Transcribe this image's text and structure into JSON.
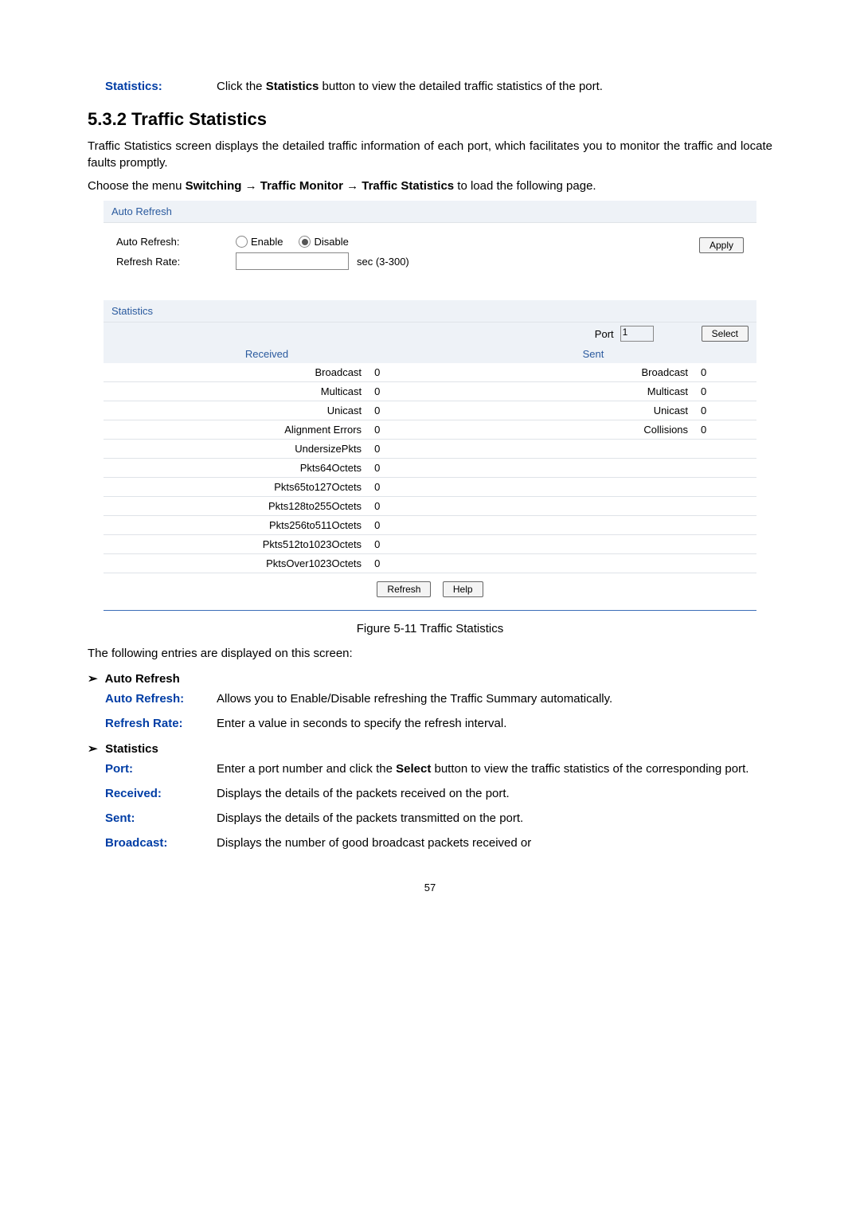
{
  "top_desc": {
    "label": "Statistics:",
    "text_prefix": "Click the ",
    "text_bold": "Statistics",
    "text_suffix": " button to view the detailed traffic statistics of the port."
  },
  "heading": "5.3.2 Traffic Statistics",
  "intro": "Traffic Statistics screen displays the detailed traffic information of each port, which facilitates you to monitor the traffic and locate faults promptly.",
  "menu_line_prefix": "Choose the menu ",
  "menu_line_bold": "Switching → Traffic Monitor → Traffic Statistics",
  "menu_line_suffix": " to load the following page.",
  "auto_refresh_panel": {
    "title": "Auto Refresh",
    "auto_refresh_label": "Auto Refresh:",
    "enable_label": "Enable",
    "disable_label": "Disable",
    "refresh_rate_label": "Refresh Rate:",
    "rate_hint": "sec (3-300)",
    "apply_button": "Apply"
  },
  "stats_panel": {
    "title": "Statistics",
    "port_label": "Port",
    "port_value": "1",
    "select_button": "Select",
    "received_header": "Received",
    "sent_header": "Sent",
    "received_rows": [
      {
        "label": "Broadcast",
        "value": "0"
      },
      {
        "label": "Multicast",
        "value": "0"
      },
      {
        "label": "Unicast",
        "value": "0"
      },
      {
        "label": "Alignment Errors",
        "value": "0"
      },
      {
        "label": "UndersizePkts",
        "value": "0"
      },
      {
        "label": "Pkts64Octets",
        "value": "0"
      },
      {
        "label": "Pkts65to127Octets",
        "value": "0"
      },
      {
        "label": "Pkts128to255Octets",
        "value": "0"
      },
      {
        "label": "Pkts256to511Octets",
        "value": "0"
      },
      {
        "label": "Pkts512to1023Octets",
        "value": "0"
      },
      {
        "label": "PktsOver1023Octets",
        "value": "0"
      }
    ],
    "sent_rows": [
      {
        "label": "Broadcast",
        "value": "0"
      },
      {
        "label": "Multicast",
        "value": "0"
      },
      {
        "label": "Unicast",
        "value": "0"
      },
      {
        "label": "Collisions",
        "value": "0"
      }
    ],
    "refresh_button": "Refresh",
    "help_button": "Help"
  },
  "figure_caption": "Figure 5-11 Traffic Statistics",
  "entries_intro": "The following entries are displayed on this screen:",
  "section1_title": "Auto Refresh",
  "section2_title": "Statistics",
  "entries1": [
    {
      "label": "Auto Refresh:",
      "text": "Allows you to Enable/Disable refreshing the Traffic Summary automatically."
    },
    {
      "label": "Refresh Rate:",
      "text": "Enter a value in seconds to specify the refresh interval."
    }
  ],
  "entries2": [
    {
      "label": "Port:",
      "text_prefix": "Enter a port number and click the ",
      "text_bold": "Select",
      "text_suffix": " button to view the traffic statistics of the corresponding port."
    },
    {
      "label": "Received:",
      "text": "Displays the details of the packets received on the port."
    },
    {
      "label": "Sent:",
      "text": "Displays the details of the packets transmitted on the port."
    },
    {
      "label": "Broadcast:",
      "text": "Displays the number of good broadcast packets received or"
    }
  ],
  "page_number": "57"
}
